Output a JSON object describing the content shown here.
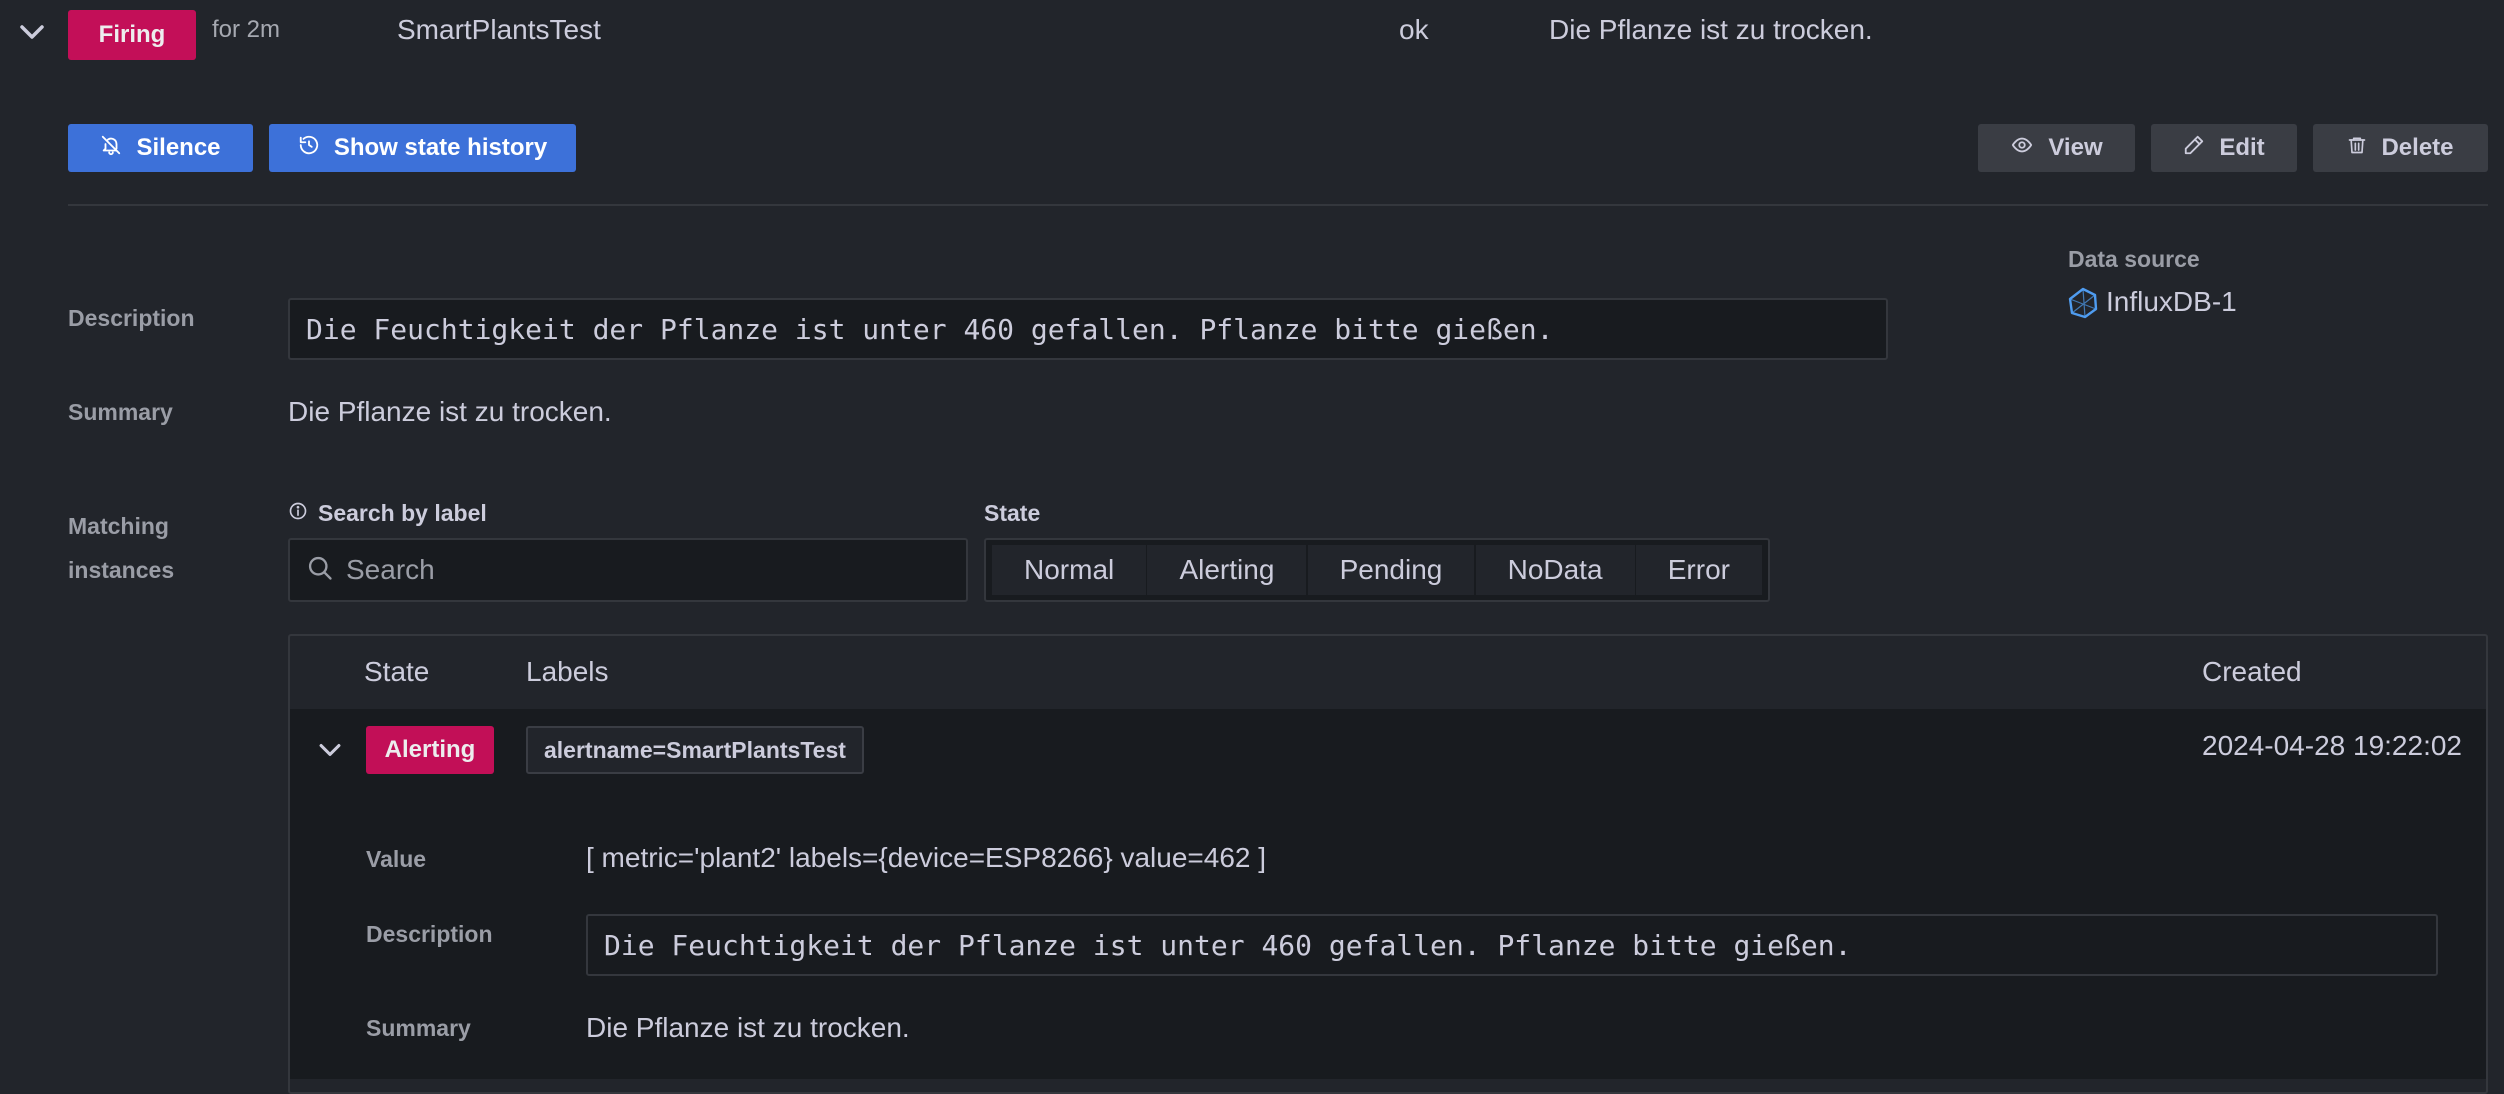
{
  "rule": {
    "state": "Firing",
    "duration": "for 2m",
    "name": "SmartPlantsTest",
    "health": "ok",
    "summary": "Die Pflanze ist zu trocken."
  },
  "actions": {
    "silence": "Silence",
    "show_history": "Show state history",
    "view": "View",
    "edit": "Edit",
    "delete": "Delete"
  },
  "details": {
    "description_label": "Description",
    "description": "Die Feuchtigkeit der Pflanze ist unter 460 gefallen. Pflanze bitte gießen.",
    "summary_label": "Summary",
    "summary": "Die Pflanze ist zu trocken.",
    "matching_label_line1": "Matching",
    "matching_label_line2": "instances",
    "datasource_label": "Data source",
    "datasource_name": "InfluxDB-1"
  },
  "filters": {
    "search_label": "Search by label",
    "search_placeholder": "Search",
    "state_label": "State",
    "states": [
      "Normal",
      "Alerting",
      "Pending",
      "NoData",
      "Error"
    ]
  },
  "table": {
    "headers": {
      "state": "State",
      "labels": "Labels",
      "created": "Created"
    },
    "rows": [
      {
        "state": "Alerting",
        "label": "alertname=SmartPlantsTest",
        "created": "2024-04-28 19:22:02",
        "value_label": "Value",
        "value": "[ metric='plant2' labels={device=ESP8266} value=462 ]",
        "description_label": "Description",
        "description": "Die Feuchtigkeit der Pflanze ist unter 460 gefallen. Pflanze bitte gießen.",
        "summary_label": "Summary",
        "summary": "Die Pflanze ist zu trocken."
      }
    ]
  },
  "colors": {
    "background": "#22252b",
    "firing": "#d10e5c",
    "primary": "#3d71d9",
    "secondary": "#3a3d44"
  }
}
